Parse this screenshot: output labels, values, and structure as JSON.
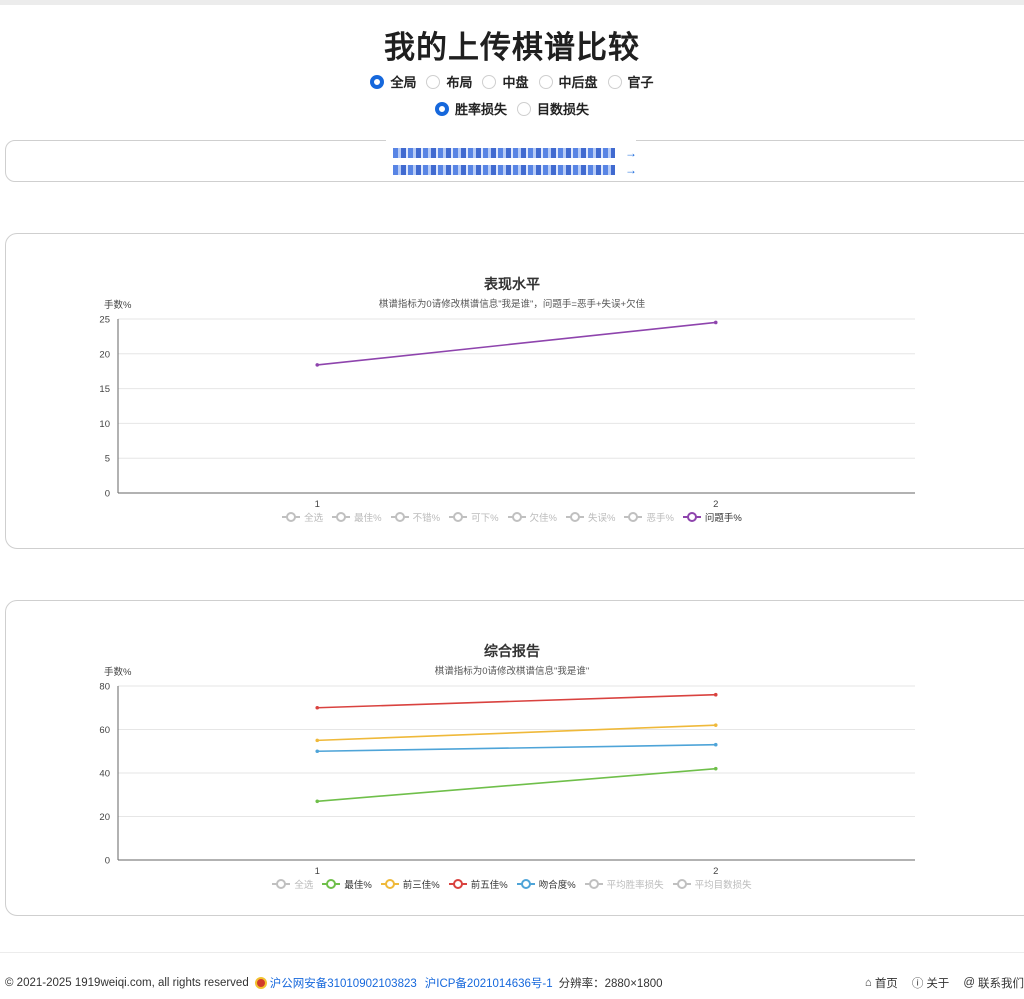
{
  "page": {
    "title": "我的上传棋谱比较"
  },
  "phase_options": [
    {
      "label": "全局",
      "selected": true
    },
    {
      "label": "布局",
      "selected": false
    },
    {
      "label": "中盘",
      "selected": false
    },
    {
      "label": "中后盘",
      "selected": false
    },
    {
      "label": "官子",
      "selected": false
    }
  ],
  "metric_options": [
    {
      "label": "胜率损失",
      "selected": true
    },
    {
      "label": "目数损失",
      "selected": false
    }
  ],
  "links": {
    "arrow": "→"
  },
  "charts": {
    "performance": {
      "title": "表现水平",
      "subtitle": "棋谱指标为0请修改棋谱信息\"我是谁\"，问题手=恶手+失误+欠佳",
      "ylabel": "手数%",
      "legend": [
        {
          "label": "全选",
          "on": false,
          "color": "#c0c0c0"
        },
        {
          "label": "最佳%",
          "on": false,
          "color": "#c0c0c0"
        },
        {
          "label": "不错%",
          "on": false,
          "color": "#c0c0c0"
        },
        {
          "label": "可下%",
          "on": false,
          "color": "#c0c0c0"
        },
        {
          "label": "欠佳%",
          "on": false,
          "color": "#c0c0c0"
        },
        {
          "label": "失误%",
          "on": false,
          "color": "#c0c0c0"
        },
        {
          "label": "恶手%",
          "on": false,
          "color": "#c0c0c0"
        },
        {
          "label": "问题手%",
          "on": true,
          "color": "#8e44ad"
        }
      ]
    },
    "summary": {
      "title": "综合报告",
      "subtitle": "棋谱指标为0请修改棋谱信息\"我是谁\"",
      "ylabel": "手数%",
      "legend": [
        {
          "label": "全选",
          "on": false,
          "color": "#c0c0c0"
        },
        {
          "label": "最佳%",
          "on": true,
          "color": "#6fbf4a"
        },
        {
          "label": "前三佳%",
          "on": true,
          "color": "#efb93a"
        },
        {
          "label": "前五佳%",
          "on": true,
          "color": "#d9423f"
        },
        {
          "label": "吻合度%",
          "on": true,
          "color": "#4ea4d8"
        },
        {
          "label": "平均胜率损失",
          "on": false,
          "color": "#c0c0c0"
        },
        {
          "label": "平均目数损失",
          "on": false,
          "color": "#c0c0c0"
        }
      ]
    }
  },
  "chart_data": [
    {
      "type": "line",
      "title": "表现水平",
      "subtitle": "棋谱指标为0请修改棋谱信息\"我是谁\"，问题手=恶手+失误+欠佳",
      "ylabel": "手数%",
      "xlabel": "",
      "categories": [
        "1",
        "2"
      ],
      "ylim": [
        0,
        25
      ],
      "yticks": [
        0,
        5,
        10,
        15,
        20,
        25
      ],
      "grid": true,
      "legend_position": "bottom",
      "series": [
        {
          "name": "问题手%",
          "color": "#8e44ad",
          "values": [
            18.4,
            24.5
          ]
        }
      ]
    },
    {
      "type": "line",
      "title": "综合报告",
      "subtitle": "棋谱指标为0请修改棋谱信息\"我是谁\"",
      "ylabel": "手数%",
      "xlabel": "",
      "categories": [
        "1",
        "2"
      ],
      "ylim": [
        0,
        80
      ],
      "yticks": [
        0,
        20,
        40,
        60,
        80
      ],
      "grid": true,
      "legend_position": "bottom",
      "series": [
        {
          "name": "最佳%",
          "color": "#6fbf4a",
          "values": [
            27,
            42
          ]
        },
        {
          "name": "前三佳%",
          "color": "#efb93a",
          "values": [
            55,
            62
          ]
        },
        {
          "name": "前五佳%",
          "color": "#d9423f",
          "values": [
            70,
            76
          ]
        },
        {
          "name": "吻合度%",
          "color": "#4ea4d8",
          "values": [
            50,
            53
          ]
        }
      ]
    }
  ],
  "footer": {
    "copyright": "© 2021-2025 1919weiqi.com, all rights reserved",
    "police_record": "沪公网安备31010902103823",
    "icp": "沪ICP备2021014636号-1",
    "resolution": "分辨率：2880×1800",
    "home": "首页",
    "about": "关于",
    "contact": "联系我们"
  }
}
